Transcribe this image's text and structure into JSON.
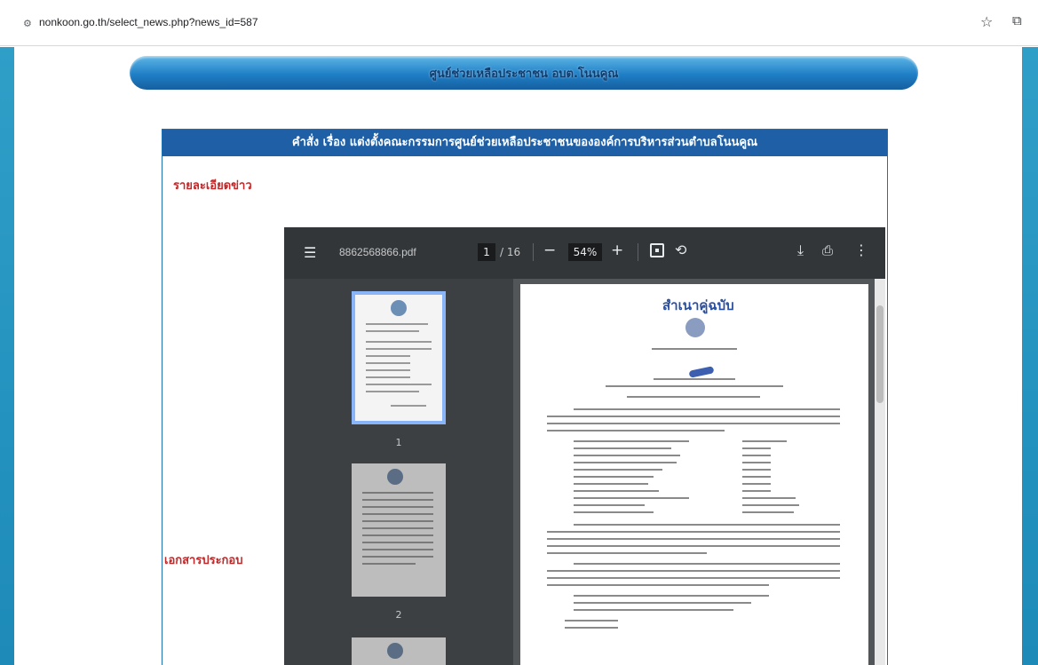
{
  "browser": {
    "url": "nonkoon.go.th/select_news.php?news_id=587",
    "site_info_icon": "tune-icon",
    "bookmark_icon": "star-icon",
    "extension_icon": "puzzle-icon"
  },
  "site": {
    "banner_text": "ศูนย์ช่วยเหลือประชาชน อบต.โนนคูณ",
    "news_title": "คำสั่ง เรื่อง แต่งตั้งคณะกรรมการศูนย์ช่วยเหลือประชาชนขององค์การบริหารส่วนตำบลโนนคูณ",
    "detail_label": "รายละเอียดข่าว",
    "attachment_label": "เอกสารประกอบ"
  },
  "pdf": {
    "filename": "8862568866.pdf",
    "current_page": "1",
    "page_total": "/ 16",
    "zoom": "54%",
    "thumbnails": [
      {
        "label": "1",
        "selected": true
      },
      {
        "label": "2",
        "selected": false
      }
    ],
    "page_stamp": "สำเนาคู่ฉบับ"
  },
  "colors": {
    "banner": "#1f7fc6",
    "news_title_bg": "#1f5fa6",
    "label_red": "#c0292a",
    "pdf_toolbar": "#323639"
  }
}
